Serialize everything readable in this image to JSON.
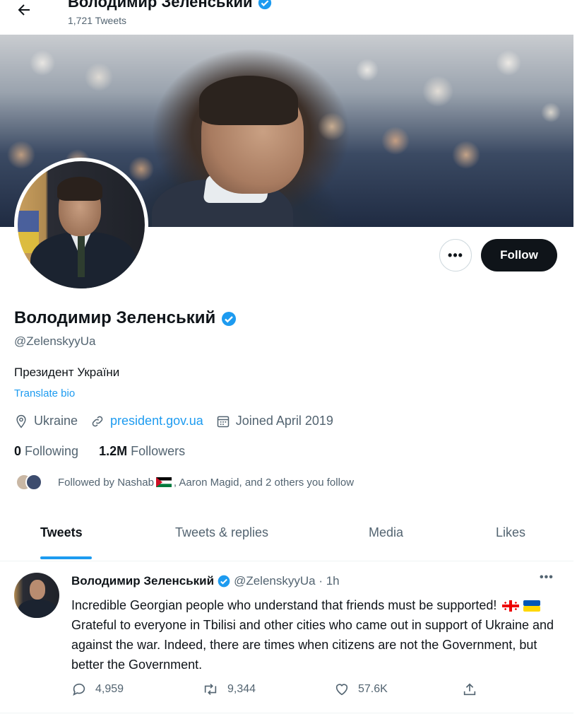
{
  "header": {
    "back_icon": "arrow-left-icon",
    "title": "Володимир Зеленський",
    "tweet_count": "1,721 Tweets"
  },
  "profile": {
    "name": "Володимир Зеленський",
    "handle": "@ZelenskyyUa",
    "bio": "Президент України",
    "translate_bio": "Translate bio",
    "location": "Ukraine",
    "website": "president.gov.ua",
    "joined": "Joined April 2019",
    "following_count": "0",
    "following_label": "Following",
    "followers_count": "1.2M",
    "followers_label": "Followers",
    "followed_by_prefix": "Followed by Nashab",
    "followed_by_suffix": ", Aaron Magid, and 2 others you follow",
    "more_label": "•••",
    "follow_label": "Follow"
  },
  "tabs": [
    {
      "label": "Tweets",
      "active": true
    },
    {
      "label": "Tweets & replies",
      "active": false
    },
    {
      "label": "Media",
      "active": false
    },
    {
      "label": "Likes",
      "active": false
    }
  ],
  "tweet": {
    "name": "Володимир Зеленський",
    "handle_time": "@ZelenskyyUa · 1h",
    "more_label": "•••",
    "text_part1": "Incredible Georgian people who understand that friends must be supported! ",
    "text_part2": " Grateful to everyone in Tbilisi and other cities who came out in support of Ukraine and against the war.  Indeed, there are times when citizens are not the Government, but better the Government.",
    "replies": "4,959",
    "retweets": "9,344",
    "likes": "57.6K"
  },
  "colors": {
    "accent": "#1d9bf0",
    "text_primary": "#0f1419",
    "text_secondary": "#536471",
    "follow_button": "#0f1419"
  }
}
